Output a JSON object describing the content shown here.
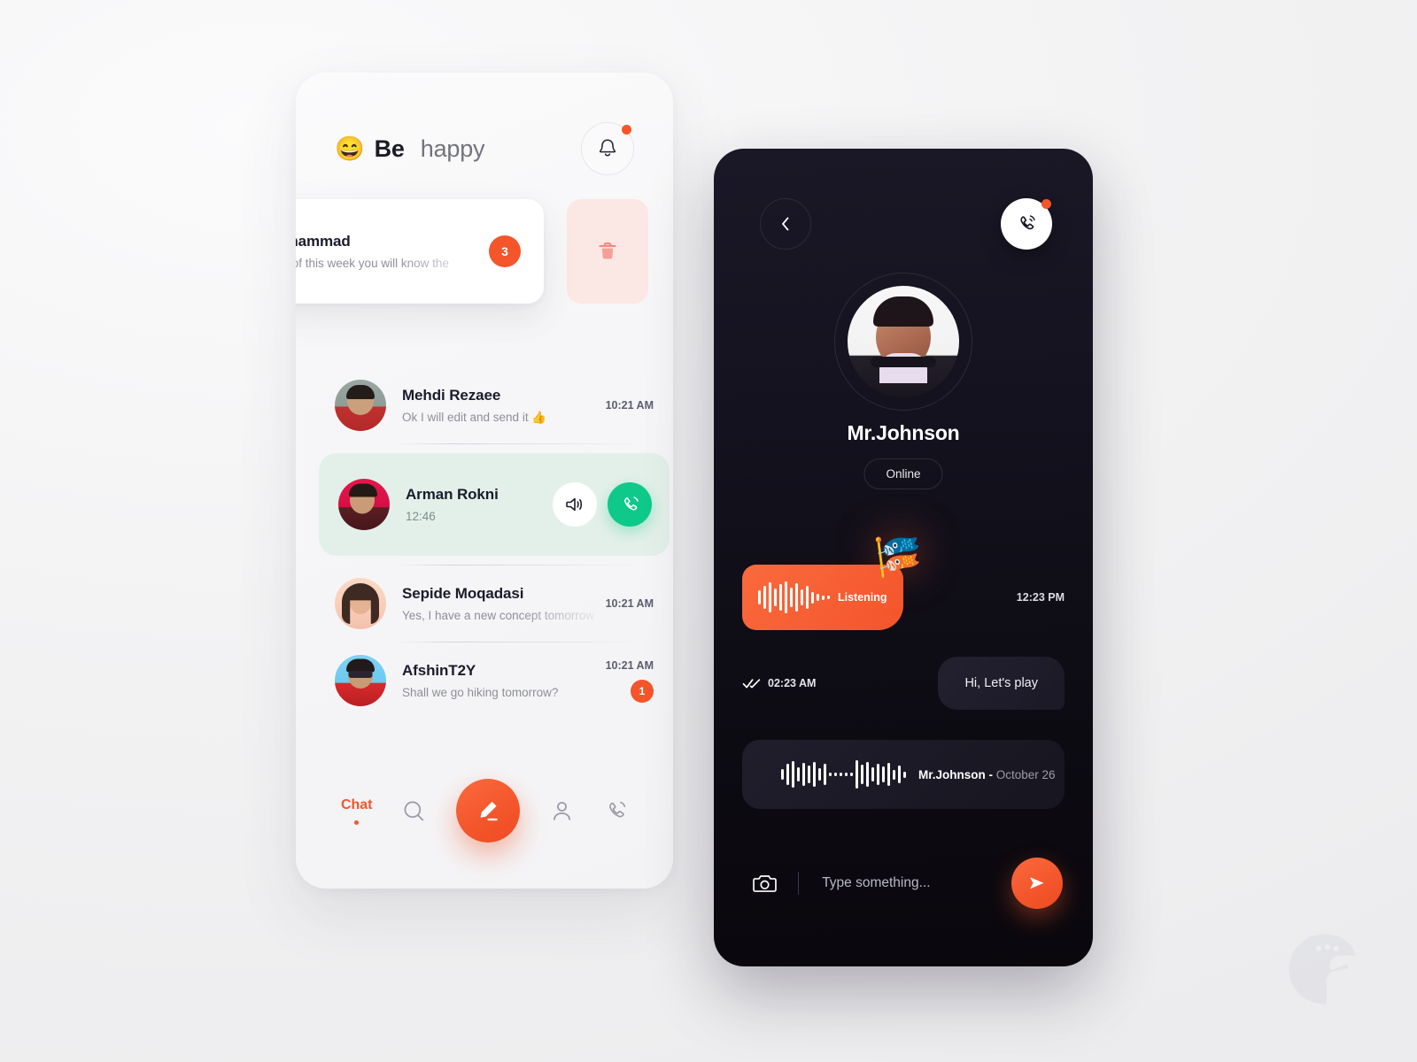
{
  "app": {
    "header": {
      "emoji": "😄",
      "title_bold": "Be",
      "title_light": "happy",
      "bell_icon": "bell-icon"
    },
    "swipe_item": {
      "name": "Mohammad",
      "preview": "End of this week you will know the",
      "badge": "3",
      "delete_icon": "trash-icon"
    },
    "chats": [
      {
        "name": "Mehdi Rezaee",
        "preview": "Ok I will edit and send it 👍",
        "time": "10:21 AM",
        "badge": ""
      },
      {
        "name": "Sepide Moqadasi",
        "preview": "Yes, I have a new concept tomorrow",
        "time": "10:21 AM",
        "badge": ""
      },
      {
        "name": "AfshinT2Y",
        "preview": "Shall we go hiking tomorrow?",
        "time": "10:21 AM",
        "badge": "1"
      }
    ],
    "incoming_call": {
      "name": "Arman Rokni",
      "time": "12:46",
      "speaker_icon": "speaker-icon",
      "answer_icon": "phone-icon"
    },
    "nav": {
      "chat_label": "Chat",
      "search_icon": "search-icon",
      "compose_icon": "pencil-icon",
      "profile_icon": "person-icon",
      "calls_icon": "phone-icon"
    }
  },
  "conversation": {
    "back_icon": "chevron-left-icon",
    "call_icon": "phone-icon",
    "contact_name": "Mr.Johnson",
    "contact_status": "Online",
    "voice_message": {
      "label": "Listening",
      "time": "12:23 PM",
      "flag_emoji": "🎏",
      "waveform": [
        14,
        22,
        30,
        18,
        26,
        34,
        20,
        28,
        16,
        24,
        12,
        8,
        5,
        3
      ]
    },
    "sent_message": {
      "time": "02:23 AM",
      "text": "Hi, Let's play",
      "ticks_icon": "double-check-icon"
    },
    "audio_track": {
      "play_icon": "play-icon",
      "artist": "Mr.Johnson -",
      "date": "October 26",
      "waveform": [
        10,
        20,
        28,
        14,
        24,
        18,
        26,
        12,
        22,
        4,
        4,
        4,
        4,
        4,
        30,
        20,
        26,
        14,
        22,
        16,
        24,
        10,
        18,
        6
      ]
    },
    "composer": {
      "camera_icon": "camera-icon",
      "placeholder": "Type something...",
      "send_icon": "send-icon"
    }
  },
  "colors": {
    "accent_orange": "#F4552B",
    "accent_green": "#0FC98A",
    "dark_panel": "#17151F",
    "light_panel": "#F6F6F8",
    "call_card_green": "#E3F0EA",
    "trash_pink": "#FBE8E5"
  },
  "watermark": {
    "name": "peacock-logo"
  }
}
